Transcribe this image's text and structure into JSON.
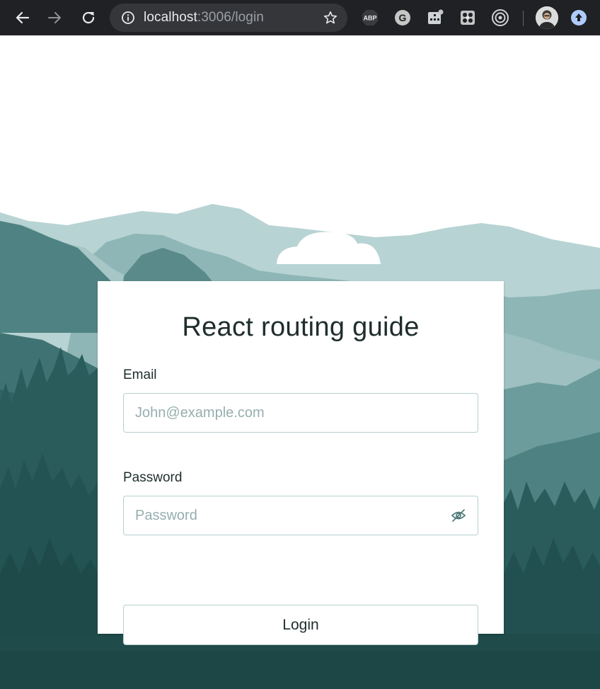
{
  "browser": {
    "url_host": "localhost",
    "url_path": ":3006/login",
    "icons": [
      "back-arrow-icon",
      "forward-arrow-icon",
      "reload-icon",
      "info-icon",
      "star-icon",
      "adblock-plus-icon",
      "grammarly-icon",
      "extension-icon",
      "extension-icon",
      "target-icon",
      "profile-avatar",
      "update-arrow-icon"
    ],
    "adblock_label": "ABP",
    "grammarly_label": "G"
  },
  "login": {
    "title": "React routing guide",
    "email_label": "Email",
    "email_placeholder": "John@example.com",
    "password_label": "Password",
    "password_placeholder": "Password",
    "submit_label": "Login"
  },
  "theme": {
    "toolbar": "#202124",
    "sky": "#ffffff",
    "mountain_far": "#b8d3d3",
    "mountain_mid": "#8ab3b3",
    "forest_dark": "#1f4f4f",
    "accent_border": "#b9cfcf"
  }
}
